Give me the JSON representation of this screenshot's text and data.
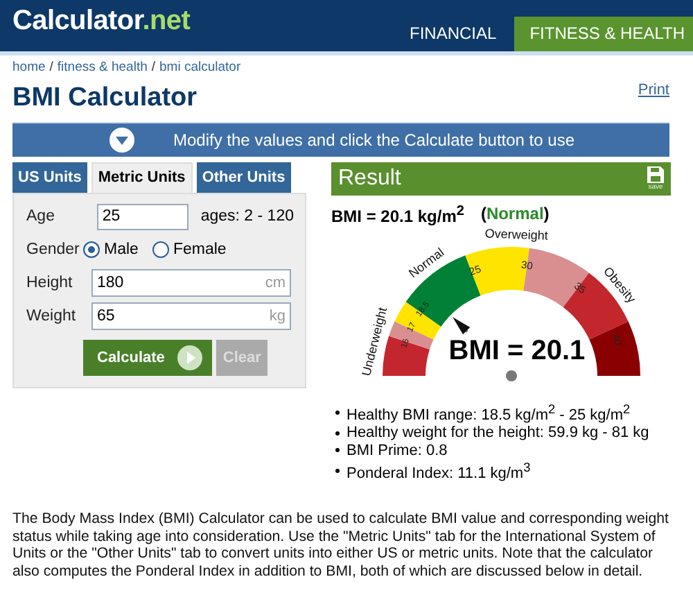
{
  "header": {
    "logo": {
      "name": "Calculator",
      "suffix": ".net"
    },
    "nav": [
      {
        "label": "FINANCIAL",
        "selected": false
      },
      {
        "label": "FITNESS & HEALTH",
        "selected": true
      }
    ]
  },
  "breadcrumb": {
    "items": [
      "home",
      "fitness & health",
      "bmi calculator"
    ],
    "separator": "/"
  },
  "print_link": "Print",
  "title": "BMI Calculator",
  "banner": "Modify the values and click the Calculate button to use",
  "form": {
    "tabs": [
      {
        "label": "US Units",
        "selected": false
      },
      {
        "label": "Metric Units",
        "selected": true
      },
      {
        "label": "Other Units",
        "selected": false
      }
    ],
    "fields": [
      {
        "kind": "text",
        "label": "Age",
        "value": "25",
        "hint": "ages: 2 - 120"
      },
      {
        "kind": "radio",
        "label": "Gender",
        "options": [
          {
            "label": "Male",
            "selected": true
          },
          {
            "label": "Female",
            "selected": false
          }
        ]
      },
      {
        "kind": "unit",
        "label": "Height",
        "value": "180",
        "unit": "cm"
      },
      {
        "kind": "unit",
        "label": "Weight",
        "value": "65",
        "unit": "kg"
      }
    ],
    "buttons": [
      {
        "label": "Calculate",
        "disabled": false
      },
      {
        "label": "Clear",
        "disabled": true
      }
    ]
  },
  "result": {
    "title": "Result",
    "save_label": "save",
    "summary": {
      "text": "BMI = 20.1 kg/m$^{2}$",
      "before": "(",
      "status": "Normal",
      "after": ")",
      "color": "#2a8a2a"
    },
    "gauge": {
      "categories": [
        "Underweight",
        "Normal",
        "Overweight",
        "Obesity"
      ],
      "ticks": [
        "16",
        "17",
        "18.5",
        "25",
        "30",
        "35",
        "40"
      ],
      "reading": "BMI = 20.1"
    },
    "details": [
      "Healthy BMI range: 18.5 kg/m$^{2}$ - 25 kg/m$^{2}$",
      "Healthy weight for the height: 59.9 kg - 81 kg",
      "BMI Prime: 0.8",
      "Ponderal Index: 11.1 kg/m$^{3}$"
    ]
  },
  "description": "The Body Mass Index (BMI) Calculator can be used to calculate BMI value and corresponding weight status while taking age into consideration. Use the \"Metric Units\" tab for the International System of Units or the \"Other Units\" tab to convert units into either US or metric units. Note that the calculator also computes the Ponderal Index in addition to BMI, both of which are discussed below in detail."
}
